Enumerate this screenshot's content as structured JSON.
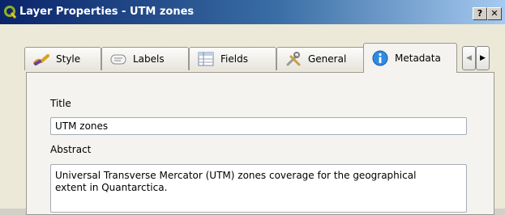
{
  "window": {
    "title": "Layer Properties - UTM zones",
    "help_label": "?",
    "close_label": "✕"
  },
  "tabs": [
    {
      "label": "Style",
      "icon": "brush-icon",
      "active": false
    },
    {
      "label": "Labels",
      "icon": "labels-icon",
      "active": false
    },
    {
      "label": "Fields",
      "icon": "table-icon",
      "active": false
    },
    {
      "label": "General",
      "icon": "tools-icon",
      "active": false
    },
    {
      "label": "Metadata",
      "icon": "info-icon",
      "active": true
    }
  ],
  "tab_scroll": {
    "left": "◀",
    "right": "▶"
  },
  "metadata": {
    "title_label": "Title",
    "title_value": "UTM zones",
    "abstract_label": "Abstract",
    "abstract_value": "Universal Transverse Mercator (UTM) zones coverage for the geographical\nextent in Quantarctica."
  },
  "colors": {
    "titlebar_start": "#0a246a",
    "titlebar_end": "#a6caf0",
    "info_icon": "#2e8be0"
  }
}
